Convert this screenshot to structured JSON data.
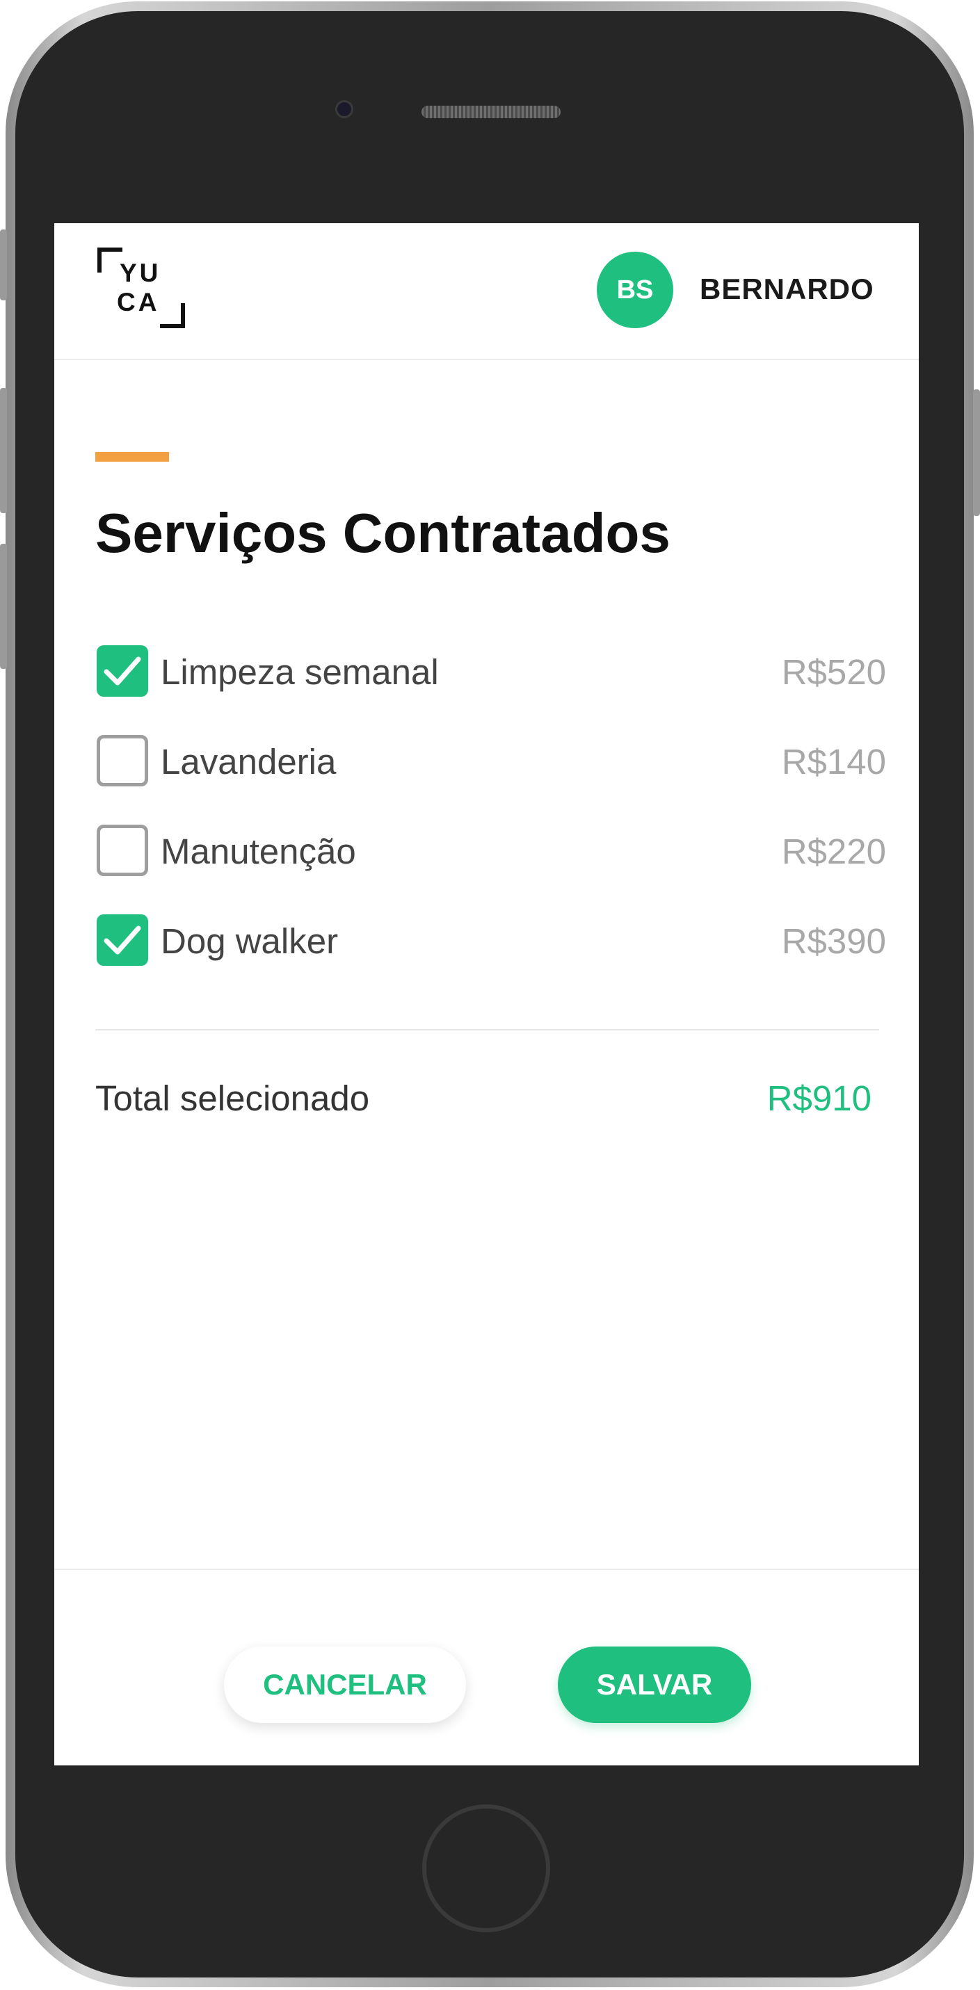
{
  "header": {
    "logo_line1": "YU",
    "logo_line2": "CA",
    "avatar_initials": "BS",
    "user_name": "BERNARDO"
  },
  "page": {
    "title": "Serviços Contratados"
  },
  "services": [
    {
      "label": "Limpeza semanal",
      "price": "R$520",
      "checked": true
    },
    {
      "label": "Lavanderia",
      "price": "R$140",
      "checked": false
    },
    {
      "label": "Manutenção",
      "price": "R$220",
      "checked": false
    },
    {
      "label": "Dog walker",
      "price": "R$390",
      "checked": true
    }
  ],
  "summary": {
    "total_label": "Total selecionado",
    "total_value": "R$910"
  },
  "actions": {
    "cancel_label": "CANCELAR",
    "save_label": "SALVAR"
  },
  "colors": {
    "accent_green": "#1fbf7f",
    "accent_orange": "#f3a043",
    "text_dark": "#111111",
    "price_gray": "#a8a8a8"
  },
  "icons": [
    "check-icon",
    "yuca-logo"
  ]
}
